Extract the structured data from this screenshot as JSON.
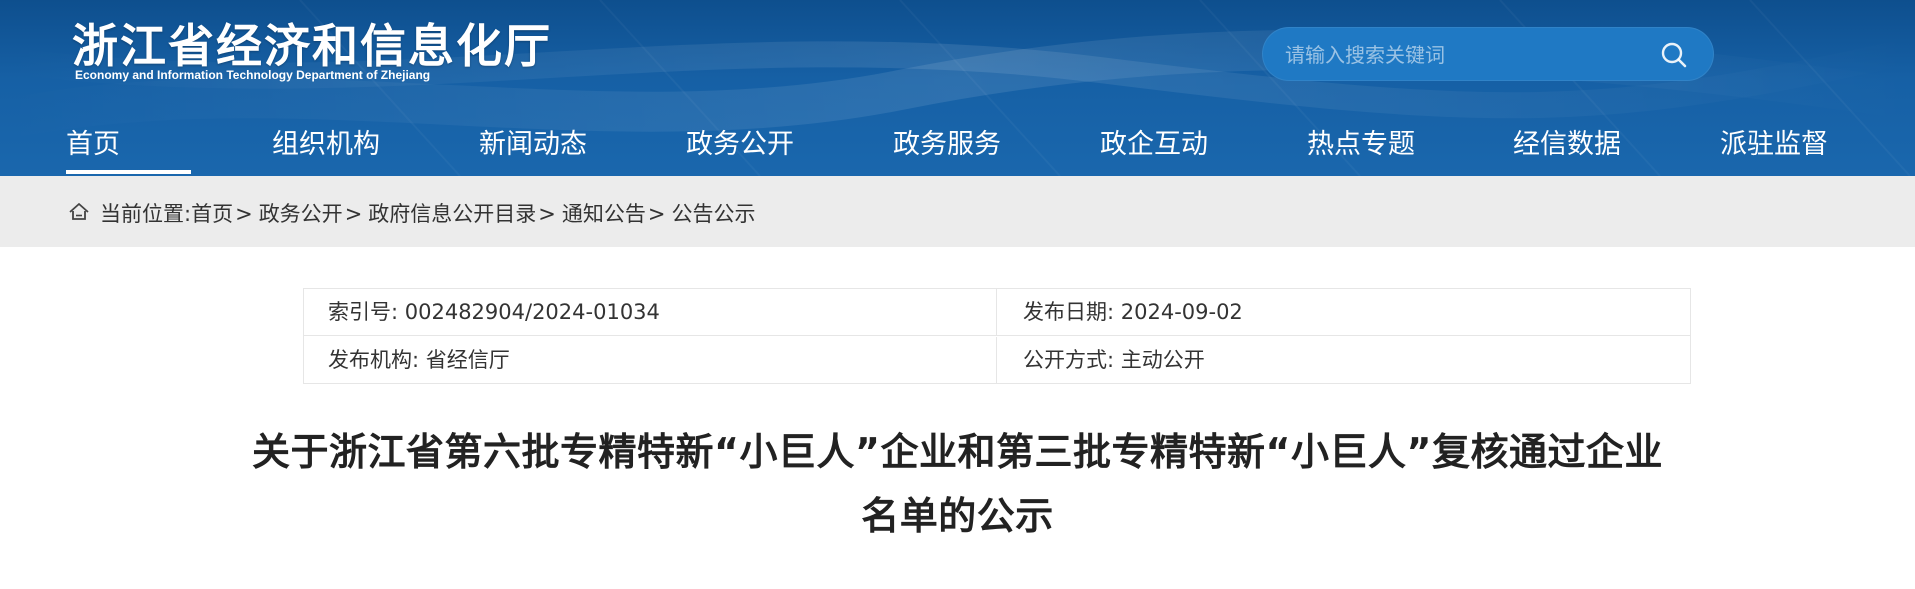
{
  "header": {
    "title": "浙江省经济和信息化厅",
    "subtitle": "Economy and Information Technology Department of Zhejiang",
    "search": {
      "placeholder": "请输入搜索关键词",
      "icon": "search-icon"
    },
    "colors": {
      "primary": "#1660a5",
      "search_bg": "#1f79c4"
    }
  },
  "nav": {
    "active_index": 0,
    "items": [
      {
        "label": "首页"
      },
      {
        "label": "组织机构"
      },
      {
        "label": "新闻动态"
      },
      {
        "label": "政务公开"
      },
      {
        "label": "政务服务"
      },
      {
        "label": "政企互动"
      },
      {
        "label": "热点专题"
      },
      {
        "label": "经信数据"
      },
      {
        "label": "派驻监督"
      }
    ]
  },
  "breadcrumb": {
    "icon": "home-icon",
    "prefix": "当前位置:",
    "items": [
      "首页",
      "政务公开",
      "政府信息公开目录",
      "通知公告",
      "公告公示"
    ],
    "separator": ">"
  },
  "info": {
    "index_no": "索引号: 002482904/2024-01034",
    "publish_date": "发布日期: 2024-09-02",
    "publisher": "发布机构: 省经信厅",
    "disclosure_method": "公开方式: 主动公开"
  },
  "article": {
    "title_line1": "关于浙江省第六批专精特新“小巨人”企业和第三批专精特新“小巨人”复核通过企业",
    "title_line2": "名单的公示"
  }
}
